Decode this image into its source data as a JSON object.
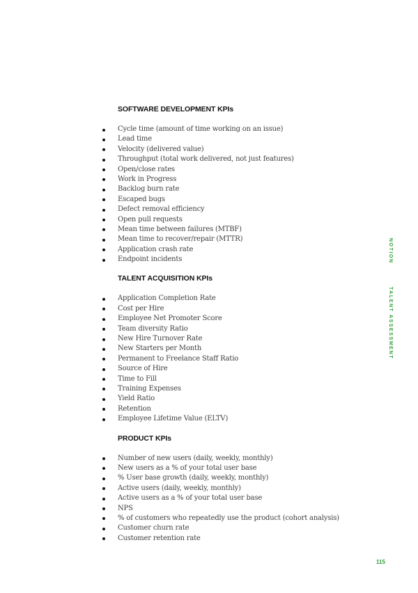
{
  "sections": [
    {
      "title": "SOFTWARE DEVELOPMENT KPIs",
      "items": [
        "Cycle time (amount of time working on an issue)",
        "Lead time",
        "Velocity (delivered value)",
        "Throughput (total work delivered, not just features)",
        "Open/close rates",
        "Work in Progress",
        "Backlog burn rate",
        "Escaped bugs",
        "Defect removal efficiency",
        "Open pull requests",
        "Mean time between failures (MTBF)",
        "Mean time to recover/repair (MTTR)",
        "Application crash rate",
        "Endpoint incidents"
      ]
    },
    {
      "title": "TALENT ACQUISITION KPIs",
      "items": [
        "Application Completion Rate",
        "Cost per Hire",
        "Employee Net Promoter Score",
        "Team diversity Ratio",
        "New Hire Turnover Rate",
        "New Starters per Month",
        "Permanent to Freelance Staff Ratio",
        "Source of Hire",
        "Time to Fill",
        "Training Expenses",
        "Yield Ratio",
        "Retention",
        "Employee Lifetime Value (ELTV)"
      ]
    },
    {
      "title": "PRODUCT KPIs",
      "items": [
        "Number of new users (daily, weekly, monthly)",
        "New users as a % of your total user base",
        "% User base growth (daily, weekly, monthly)",
        "Active users (daily, weekly, monthly)",
        "Active users as a % of your total user base",
        "NPS",
        "% of customers who repeatedly use the product (cohort analysis)",
        "Customer churn rate",
        "Customer retention rate"
      ]
    }
  ],
  "side_labels": {
    "brand": "NOTION",
    "chapter": "TALENT ASSESSMENT"
  },
  "page_number": "115",
  "colors": {
    "accent": "#2e9e3a",
    "heading": "#111111",
    "body_text": "#3d3d3d"
  }
}
